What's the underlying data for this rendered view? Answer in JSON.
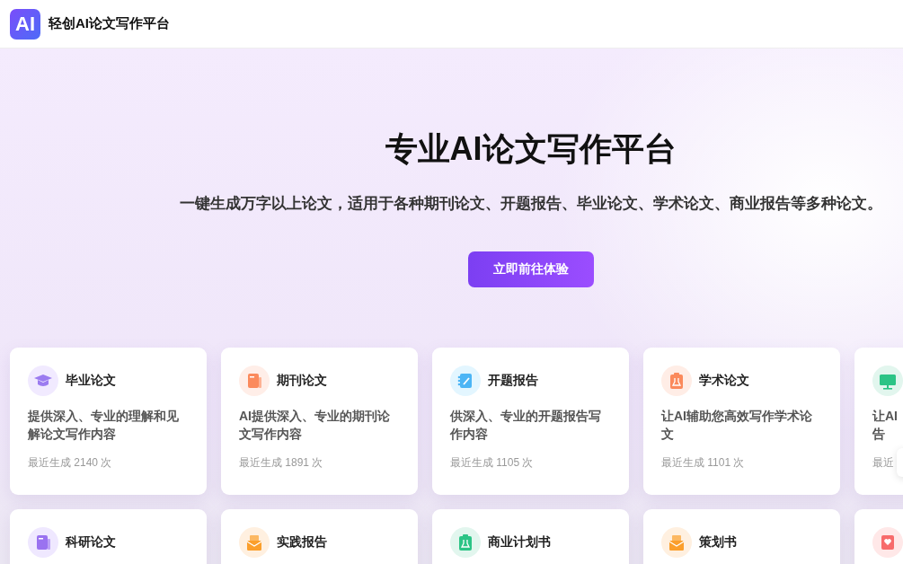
{
  "header": {
    "logo": "AI",
    "title": "轻创AI论文写作平台"
  },
  "hero": {
    "title": "专业AI论文写作平台",
    "subtitle": "一键生成万字以上论文，适用于各种期刊论文、开题报告、毕业论文、学术论文、商业报告等多种论文。",
    "button": "立即前往体验"
  },
  "cards": [
    {
      "kind": "feature",
      "title": "毕业论文",
      "lines": [
        "提供深入、专业的理解和见",
        "解论文写作内容"
      ],
      "meta": "最近生成 2140 次"
    },
    {
      "kind": "feature",
      "title": "期刊论文",
      "lines": [
        "AI提供深入、专业的期刊论",
        "文写作内容"
      ],
      "meta": "最近生成 1891 次"
    },
    {
      "kind": "feature",
      "title": "开题报告",
      "lines": [
        "供深入、专业的开题报告写",
        "作内容"
      ],
      "meta": "最近生成 1105 次"
    },
    {
      "kind": "feature",
      "title": "学术论文",
      "lines": [
        "让AI辅助您高效写作学术论",
        "文"
      ],
      "meta": "最近生成 1101 次"
    },
    {
      "kind": "feature",
      "lines": [
        "让AI",
        "告"
      ],
      "meta": "最近"
    },
    {
      "kind": "feature",
      "title": "科研论文"
    },
    {
      "kind": "feature",
      "title": "实践报告"
    },
    {
      "kind": "feature",
      "title": "商业计划书"
    },
    {
      "kind": "feature",
      "title": "策划书"
    },
    {
      "kind": "feature"
    }
  ]
}
